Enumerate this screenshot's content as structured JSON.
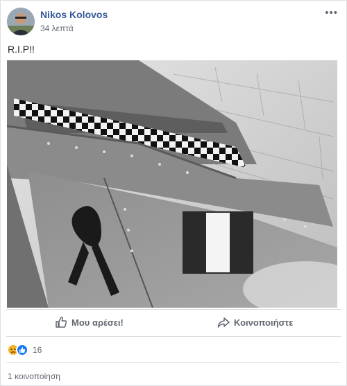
{
  "post": {
    "author": "Nikos Kolovos",
    "time": "34 λεπτά",
    "text": "R.I.P!!"
  },
  "actions": {
    "like_label": "Μου αρέσει!",
    "share_label": "Κοινοποιήστε"
  },
  "reactions": {
    "count": "16",
    "types": [
      "sad",
      "like"
    ]
  },
  "shares": {
    "label": "1 κοινοποίηση"
  },
  "colors": {
    "author_link": "#365899",
    "like_blue": "#1877f2",
    "sad_yellow": "#f7b125"
  }
}
